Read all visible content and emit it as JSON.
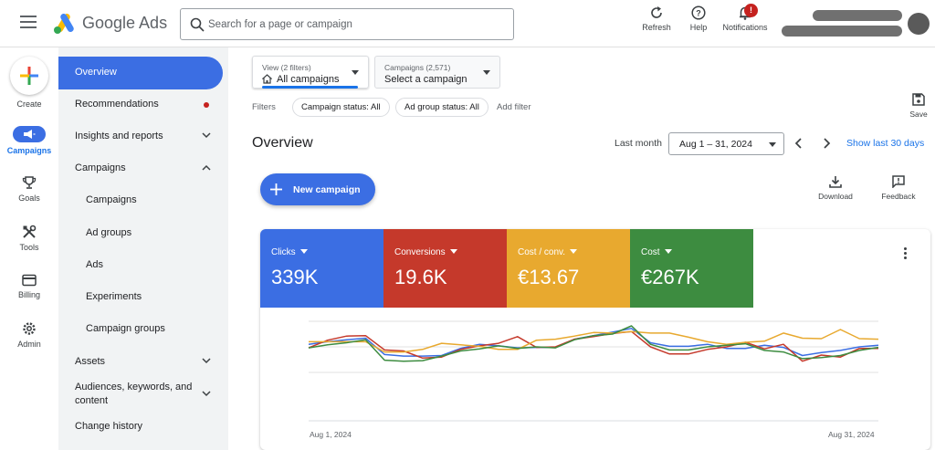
{
  "header": {
    "brand": "Google Ads",
    "search_placeholder": "Search for a page or campaign",
    "refresh_label": "Refresh",
    "help_label": "Help",
    "notifications_label": "Notifications",
    "notifications_count": "!"
  },
  "rail": {
    "create": "Create",
    "campaigns": "Campaigns",
    "goals": "Goals",
    "tools": "Tools",
    "billing": "Billing",
    "admin": "Admin"
  },
  "nav": {
    "items": [
      {
        "label": "Overview"
      },
      {
        "label": "Recommendations"
      },
      {
        "label": "Insights and reports"
      },
      {
        "label": "Campaigns"
      },
      {
        "label": "Campaigns"
      },
      {
        "label": "Ad groups"
      },
      {
        "label": "Ads"
      },
      {
        "label": "Experiments"
      },
      {
        "label": "Campaign groups"
      },
      {
        "label": "Assets"
      },
      {
        "label": "Audiences, keywords, and content"
      },
      {
        "label": "Change history"
      }
    ]
  },
  "main": {
    "view_small": "View (2 filters)",
    "view_value": "All campaigns",
    "campaign_small": "Campaigns (2,571)",
    "campaign_value": "Select a campaign",
    "filters_label": "Filters",
    "chips": [
      "Campaign status: All",
      "Ad group status: All"
    ],
    "add_filter": "Add filter",
    "save_label": "Save",
    "title": "Overview",
    "range_label": "Last month",
    "date_range": "Aug 1 – 31, 2024",
    "show_last": "Show last 30 days",
    "new_campaign": "New campaign",
    "download_label": "Download",
    "feedback_label": "Feedback"
  },
  "metrics": [
    {
      "label": "Clicks",
      "value": "339K",
      "color": "#3b6ee3"
    },
    {
      "label": "Conversions",
      "value": "19.6K",
      "color": "#c5392b"
    },
    {
      "label": "Cost / conv.",
      "value": "€13.67",
      "color": "#e8a92f"
    },
    {
      "label": "Cost",
      "value": "€267K",
      "color": "#3d8c40"
    }
  ],
  "chart_data": {
    "type": "line",
    "x_start_label": "Aug 1, 2024",
    "x_end_label": "Aug 31, 2024",
    "y_range": [
      0,
      100
    ],
    "grid": true,
    "series": [
      {
        "color": "#3b6ee3",
        "values": [
          55,
          60,
          64,
          67,
          35,
          32,
          32,
          33,
          47,
          55,
          52,
          48,
          49,
          49,
          65,
          72,
          79,
          86,
          58,
          51,
          51,
          55,
          47,
          47,
          53,
          49,
          33,
          39,
          43,
          50,
          53
        ]
      },
      {
        "color": "#c5392b",
        "values": [
          48,
          63,
          71,
          72,
          44,
          42,
          28,
          30,
          45,
          52,
          57,
          70,
          49,
          50,
          65,
          70,
          76,
          80,
          50,
          36,
          36,
          45,
          50,
          59,
          46,
          55,
          22,
          34,
          30,
          47,
          47
        ]
      },
      {
        "color": "#e8a92f",
        "values": [
          60,
          60,
          60,
          60,
          40,
          40,
          45,
          57,
          54,
          51,
          45,
          45,
          63,
          65,
          71,
          78,
          77,
          80,
          77,
          77,
          69,
          60,
          55,
          59,
          61,
          77,
          67,
          66,
          84,
          66,
          65
        ]
      },
      {
        "color": "#3d8c40",
        "values": [
          48,
          54,
          58,
          64,
          24,
          22,
          23,
          32,
          42,
          46,
          52,
          47,
          50,
          48,
          64,
          72,
          75,
          91,
          55,
          44,
          44,
          50,
          53,
          56,
          43,
          40,
          27,
          29,
          33,
          43,
          49
        ]
      }
    ]
  }
}
